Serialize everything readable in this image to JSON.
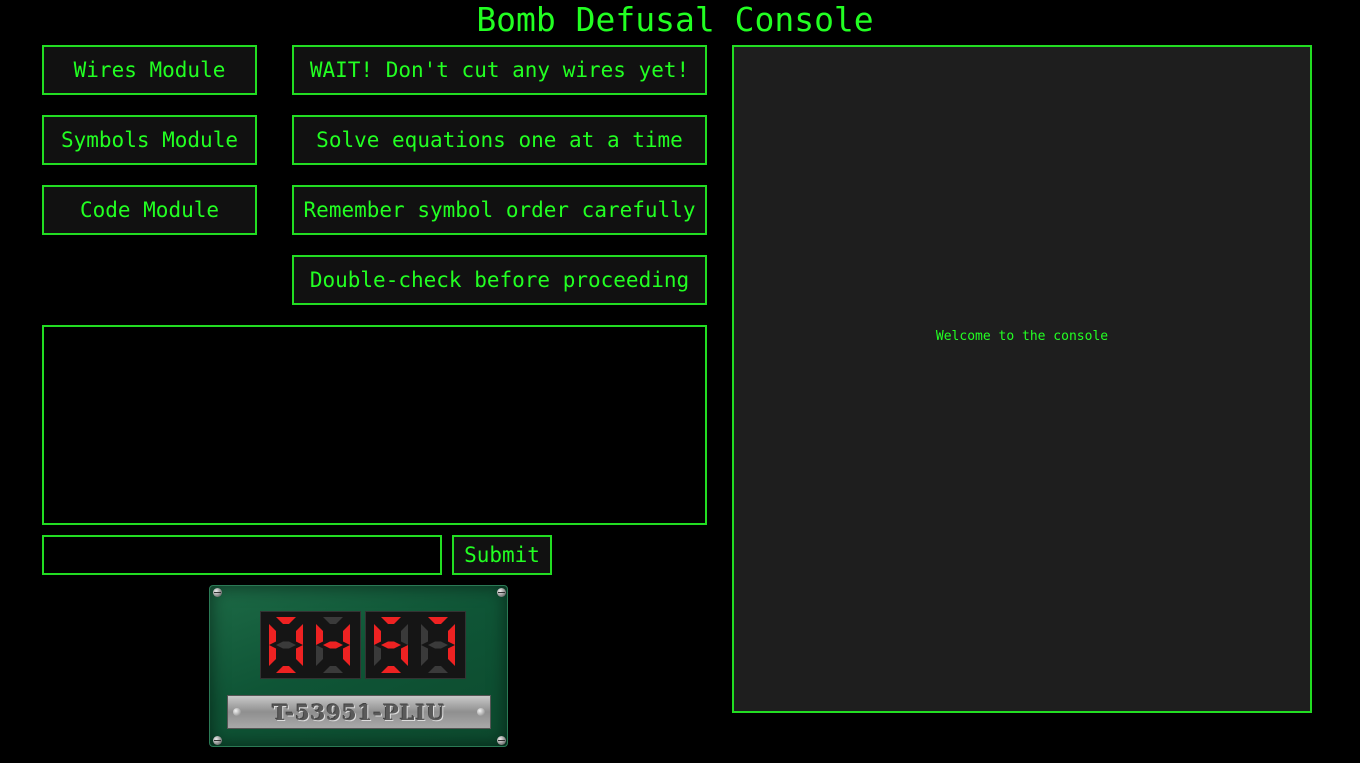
{
  "title": "Bomb Defusal Console",
  "modules": [
    {
      "label": "Wires Module"
    },
    {
      "label": "Symbols Module"
    },
    {
      "label": "Code Module"
    }
  ],
  "hints": [
    {
      "label": "WAIT! Don't cut any wires yet!"
    },
    {
      "label": "Solve equations one at a time"
    },
    {
      "label": "Remember symbol order carefully"
    },
    {
      "label": "Double-check before proceeding"
    }
  ],
  "input": {
    "value": "",
    "placeholder": ""
  },
  "submit_label": "Submit",
  "console": {
    "message": "Welcome to the console"
  },
  "timer": {
    "digits": [
      "0",
      "4",
      "5",
      "7"
    ],
    "serial": "T-53951-PLIU",
    "digit_color": "#ee2222",
    "digit_off_color": "#3a3a3a"
  },
  "colors": {
    "accent": "#22ff22",
    "background": "#000000",
    "console_bg": "#1e1e1e",
    "board": "#0f5536"
  }
}
